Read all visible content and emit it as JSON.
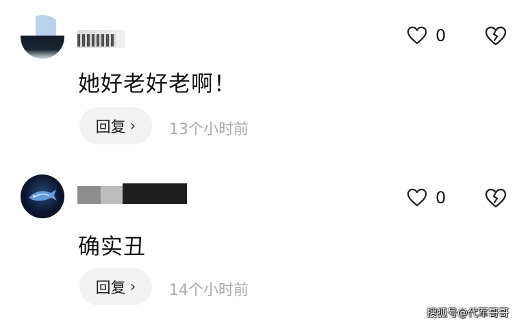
{
  "comments": [
    {
      "username": "",
      "text": "她好老好老啊！",
      "reply_label": "回复",
      "reply_chevron": "›",
      "timestamp": "13个小时前",
      "like_count": "0",
      "like_icon": "heart-outline-icon",
      "dislike_icon": "broken-heart-icon"
    },
    {
      "username": "",
      "text": "确实丑",
      "reply_label": "回复",
      "reply_chevron": "›",
      "timestamp": "14个小时前",
      "like_count": "0",
      "like_icon": "heart-outline-icon",
      "dislike_icon": "broken-heart-icon"
    }
  ],
  "watermark": "搜狐号@代军哥哥",
  "colors": {
    "text": "#111111",
    "timestamp": "#a9a9a9",
    "reply_bg": "#f2f2f2"
  }
}
